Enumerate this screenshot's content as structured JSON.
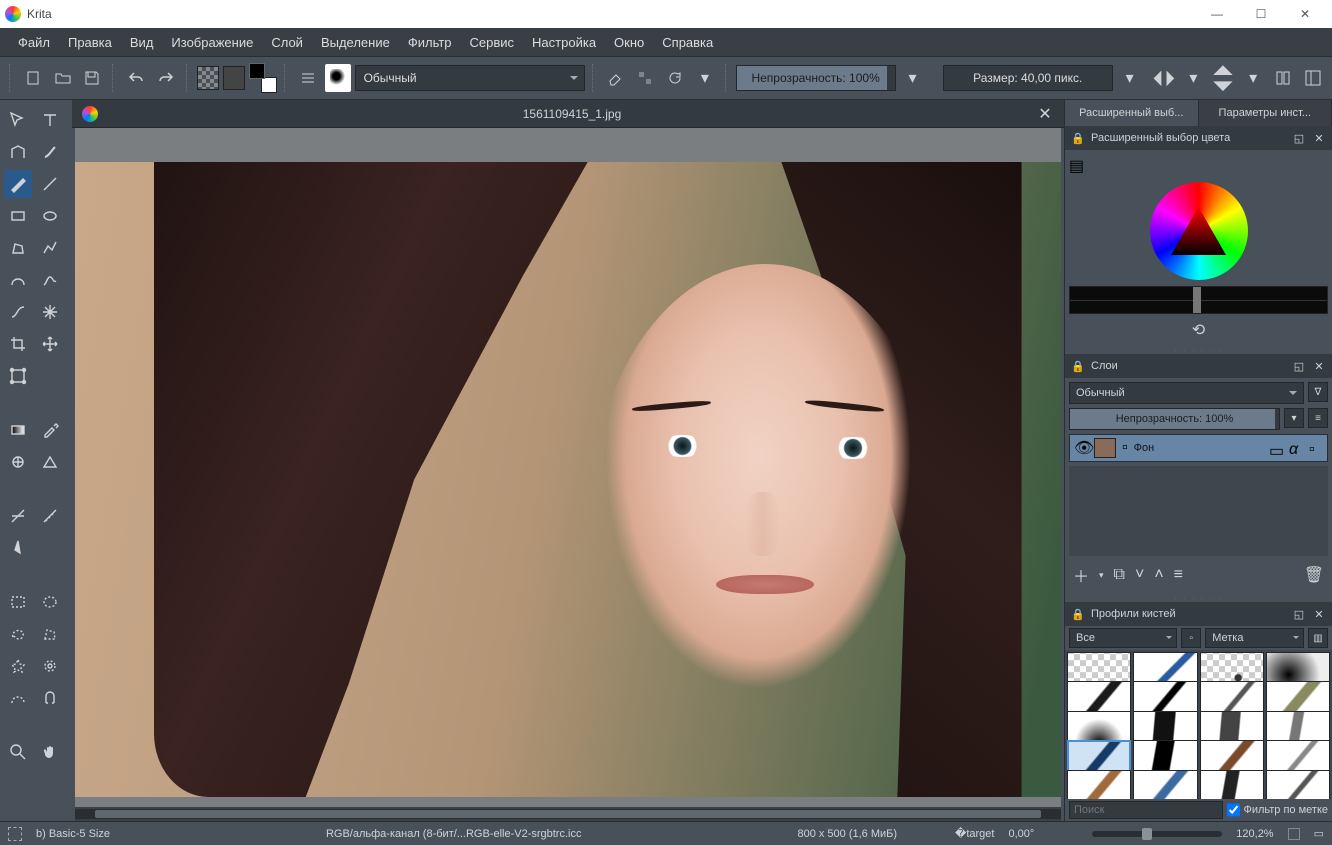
{
  "app": {
    "title": "Krita"
  },
  "win": {
    "min": "—",
    "max": "☐",
    "close": "✕"
  },
  "menu": [
    "Файл",
    "Правка",
    "Вид",
    "Изображение",
    "Слой",
    "Выделение",
    "Фильтр",
    "Сервис",
    "Настройка",
    "Окно",
    "Справка"
  ],
  "toolbar": {
    "blend_mode": "Обычный",
    "opacity_label": "Непрозрачность: 100%",
    "size_label": "Размер: 40,00 пикс."
  },
  "doc": {
    "filename": "1561109415_1.jpg"
  },
  "right_tabs": {
    "advanced": "Расширенный выб...",
    "tool_opts": "Параметры инст..."
  },
  "color_panel": {
    "title": "Расширенный выбор цвета"
  },
  "layers_panel": {
    "title": "Слои",
    "blend": "Обычный",
    "opacity": "Непрозрачность:  100%",
    "layer_name": "Фон"
  },
  "brush_panel": {
    "title": "Профили кистей",
    "filter_all": "Все",
    "filter_tag": "Метка",
    "search_placeholder": "Поиск",
    "filter_by_tag": "Фильтр по метке"
  },
  "status": {
    "brush": "b) Basic-5 Size",
    "color_info": "RGB/альфа-канал (8-бит/...RGB-elle-V2-srgbtrc.icc",
    "dims": "800 x 500 (1,6 МиБ)",
    "angle": "0,00°",
    "zoom": "120,2%"
  }
}
